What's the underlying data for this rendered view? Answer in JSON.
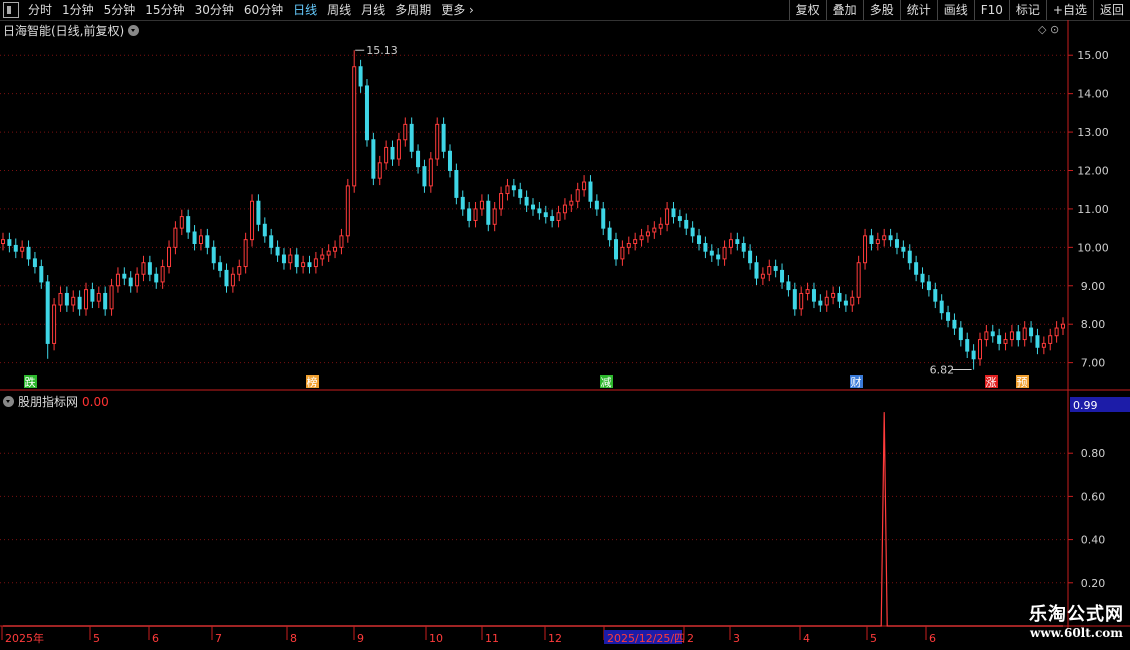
{
  "toolbar": {
    "tabs": [
      "分时",
      "1分钟",
      "5分钟",
      "15分钟",
      "30分钟",
      "60分钟",
      "日线",
      "周线",
      "月线",
      "多周期",
      "更多"
    ],
    "active": "日线",
    "right_buttons": [
      "复权",
      "叠加",
      "多股",
      "统计",
      "画线",
      "F10",
      "标记",
      "+自选",
      "返回"
    ]
  },
  "chart_title": "日海智能(日线,前复权)",
  "indicator_title": "股朋指标网",
  "indicator_value": "0.00",
  "indicator_badge": "0.99",
  "high_label": "15.13",
  "low_label": "6.82",
  "price_ticks": [
    "15.00",
    "14.00",
    "13.00",
    "12.00",
    "11.00",
    "10.00",
    "9.00",
    "8.00",
    "7.00"
  ],
  "ind_ticks": [
    "0.80",
    "0.60",
    "0.40",
    "0.20"
  ],
  "markers": [
    {
      "text": "跌",
      "color": "#2db82d"
    },
    {
      "text": "榜",
      "color": "#f0a030"
    },
    {
      "text": "减",
      "color": "#2db82d"
    },
    {
      "text": "财",
      "color": "#3a7ad8"
    },
    {
      "text": "涨",
      "color": "#e02020"
    },
    {
      "text": "预",
      "color": "#f0a030"
    }
  ],
  "date_axis": [
    "2025年",
    "5",
    "6",
    "7",
    "8",
    "9",
    "10",
    "11",
    "12",
    "2025/12/25/四",
    "2",
    "3",
    "4",
    "5",
    "6"
  ],
  "watermark": {
    "line1": "乐淘公式网",
    "line2": "www.60lt.com"
  },
  "colors": {
    "up": "#ff3b3b",
    "down": "#3fd6e6",
    "grid": "#7a1010",
    "axis": "#c81e1e",
    "text": "#cfcfcf"
  },
  "chart_data": {
    "type": "candlestick",
    "title": "日海智能(日线,前复权)",
    "ylim": [
      6.6,
      15.5
    ],
    "price_max": 15.13,
    "price_min": 6.82,
    "series": [
      {
        "name": "close",
        "values": [
          10.2,
          10.05,
          9.9,
          10.0,
          9.7,
          9.5,
          9.1,
          7.5,
          8.5,
          8.8,
          8.5,
          8.7,
          8.4,
          8.9,
          8.6,
          8.8,
          8.4,
          9.0,
          9.3,
          9.2,
          9.0,
          9.3,
          9.6,
          9.3,
          9.1,
          9.5,
          10.0,
          10.5,
          10.8,
          10.4,
          10.1,
          10.3,
          10.0,
          9.6,
          9.4,
          9.0,
          9.3,
          9.5,
          10.2,
          11.2,
          10.6,
          10.3,
          10.0,
          9.8,
          9.6,
          9.8,
          9.5,
          9.6,
          9.5,
          9.7,
          9.8,
          9.9,
          10.0,
          10.3,
          11.6,
          14.7,
          14.2,
          12.8,
          11.8,
          12.2,
          12.6,
          12.3,
          12.8,
          13.2,
          12.5,
          12.1,
          11.6,
          12.3,
          13.2,
          12.5,
          12.0,
          11.3,
          11.0,
          10.7,
          11.0,
          11.2,
          10.6,
          11.0,
          11.4,
          11.6,
          11.5,
          11.3,
          11.1,
          11.0,
          10.9,
          10.8,
          10.7,
          10.9,
          11.1,
          11.2,
          11.5,
          11.7,
          11.2,
          11.0,
          10.5,
          10.2,
          9.7,
          10.0,
          10.1,
          10.2,
          10.3,
          10.4,
          10.5,
          10.6,
          11.0,
          10.8,
          10.7,
          10.5,
          10.3,
          10.1,
          9.9,
          9.8,
          9.7,
          10.0,
          10.2,
          10.1,
          9.9,
          9.6,
          9.2,
          9.3,
          9.5,
          9.4,
          9.1,
          8.9,
          8.4,
          8.8,
          8.9,
          8.6,
          8.5,
          8.7,
          8.8,
          8.6,
          8.5,
          8.7,
          9.6,
          10.3,
          10.1,
          10.2,
          10.3,
          10.2,
          10.0,
          9.9,
          9.6,
          9.3,
          9.1,
          8.9,
          8.6,
          8.3,
          8.1,
          7.9,
          7.6,
          7.3,
          7.1,
          7.6,
          7.8,
          7.7,
          7.5,
          7.6,
          7.8,
          7.6,
          7.9,
          7.7,
          7.4,
          7.5,
          7.7,
          7.9,
          8.0
        ]
      }
    ],
    "indicator": {
      "name": "股朋指标网",
      "max": 0.99,
      "spike_index": 138,
      "ylim": [
        0,
        1.0
      ],
      "ticks": [
        0.2,
        0.4,
        0.6,
        0.8
      ]
    }
  }
}
